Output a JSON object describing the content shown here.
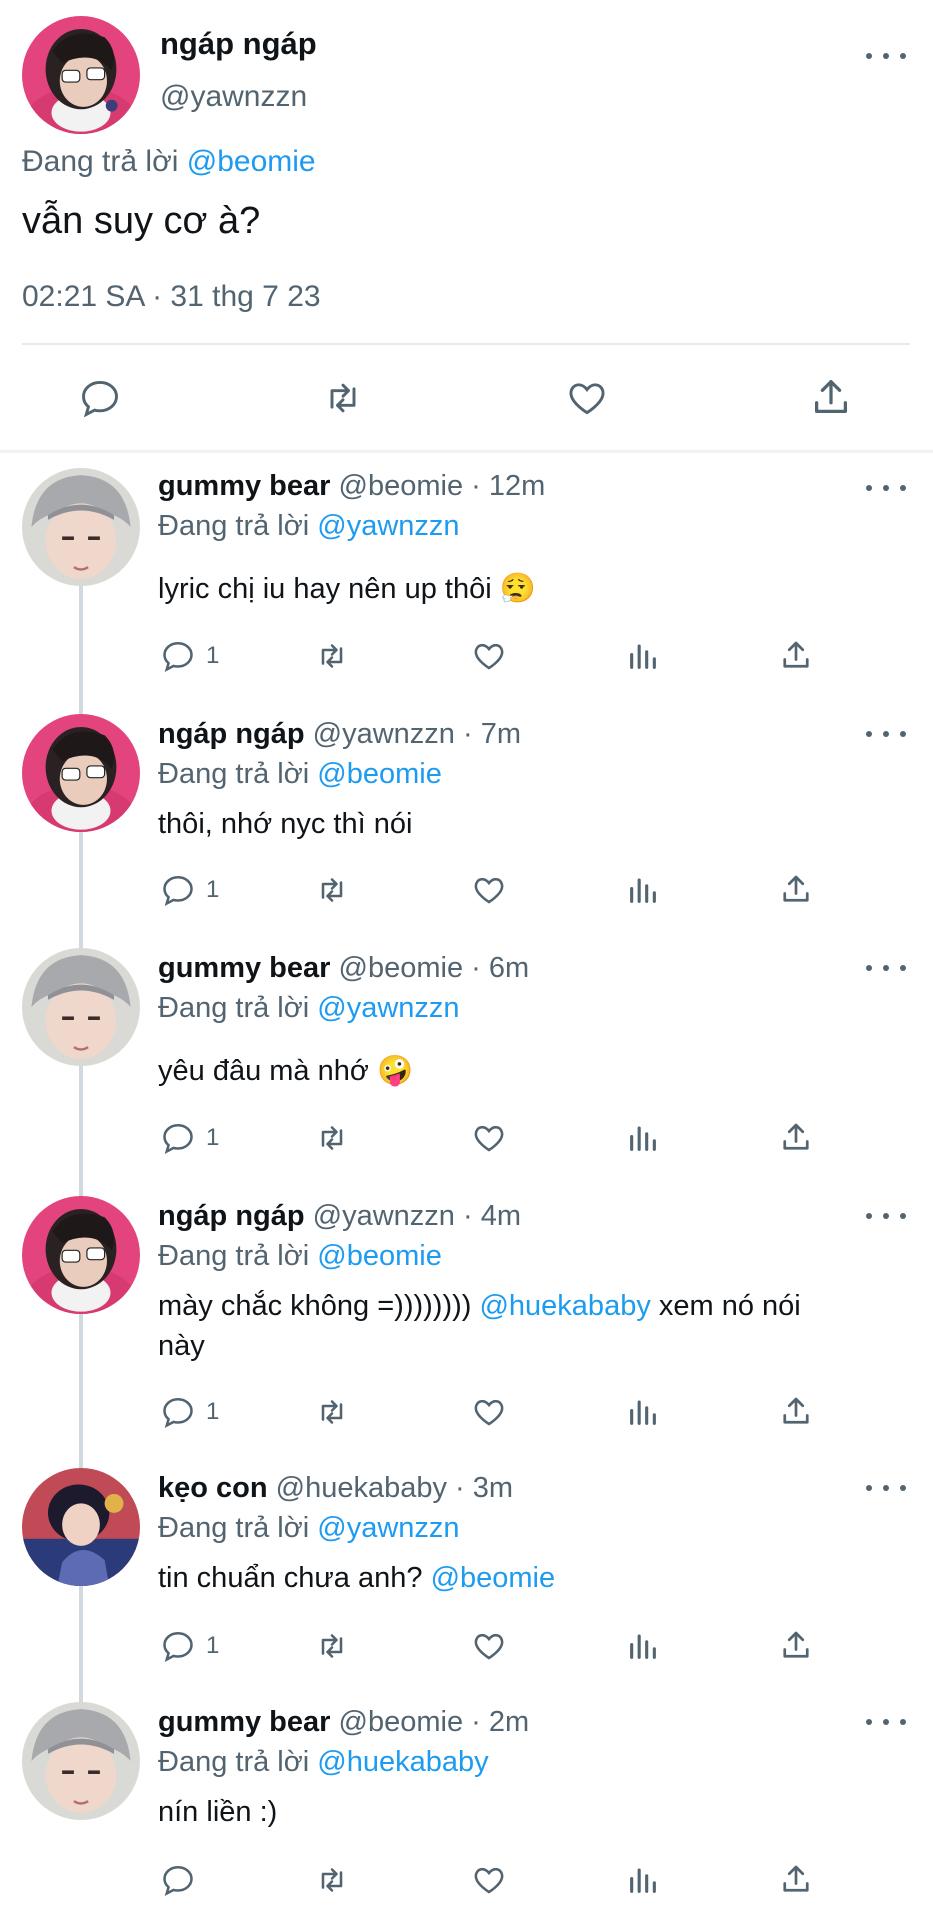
{
  "main_tweet": {
    "display_name": "ngáp ngáp",
    "handle": "@yawnzzn",
    "replying_prefix": "Đang trả lời",
    "replying_to": "@beomie",
    "text": "vẫn suy cơ à?",
    "timestamp": "02:21 SA · 31 thg 7 23"
  },
  "replies": [
    {
      "display_name": "gummy bear",
      "meta": "@beomie · 12m",
      "replying_prefix": "Đang trả lời",
      "replying_to": "@yawnzzn",
      "text": "lyric chị iu hay nên up thôi",
      "emoji": "😮‍💨",
      "reply_count": "1"
    },
    {
      "display_name": "ngáp ngáp",
      "meta": "@yawnzzn · 7m",
      "replying_prefix": "Đang trả lời",
      "replying_to": "@beomie",
      "text": "thôi, nhớ nyc thì nói",
      "reply_count": "1"
    },
    {
      "display_name": "gummy bear",
      "meta": "@beomie · 6m",
      "replying_prefix": "Đang trả lời",
      "replying_to": "@yawnzzn",
      "text": "yêu đâu mà nhớ",
      "emoji": "🤪",
      "reply_count": "1"
    },
    {
      "display_name": "ngáp ngáp",
      "meta": "@yawnzzn · 4m",
      "replying_prefix": "Đang trả lời",
      "replying_to": "@beomie",
      "text_a": "mày chắc không =))))))))",
      "mention": "@huekababy",
      "text_b": "xem nó nói",
      "text_line2": "này",
      "reply_count": "1"
    },
    {
      "display_name": "kẹo con",
      "meta": "@huekababy · 3m",
      "replying_prefix": "Đang trả lời",
      "replying_to": "@yawnzzn",
      "text": "tin chuẩn chưa anh?",
      "mention": "@beomie",
      "reply_count": "1"
    },
    {
      "display_name": "gummy bear",
      "meta": "@beomie · 2m",
      "replying_prefix": "Đang trả lời",
      "replying_to": "@huekababy",
      "text": "nín liền :)",
      "reply_count": ""
    }
  ],
  "icons": {
    "more": "more-horizontal-icon",
    "reply": "reply-bubble-icon",
    "retweet": "retweet-icon",
    "like": "heart-icon",
    "views": "bar-chart-icon",
    "share": "share-upload-icon"
  },
  "colors": {
    "link": "#1d9bf0",
    "secondary": "#536471",
    "text": "#0f1419",
    "divider": "#cfd9de"
  }
}
